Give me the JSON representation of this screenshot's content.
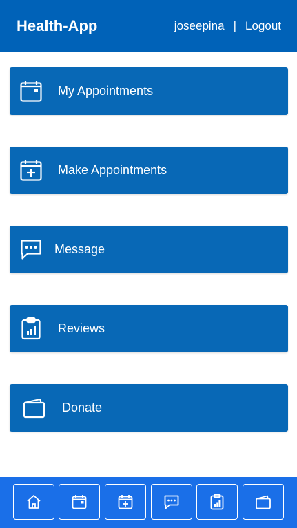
{
  "header": {
    "app_title": "Health-App",
    "username": "joseepina",
    "separator": "|",
    "logout_label": "Logout"
  },
  "menu": {
    "items": [
      {
        "label": "My Appointments",
        "icon": "calendar-icon"
      },
      {
        "label": "Make Appointments",
        "icon": "calendar-plus-icon"
      },
      {
        "label": "Message",
        "icon": "chat-icon"
      },
      {
        "label": "Reviews",
        "icon": "clipboard-chart-icon"
      },
      {
        "label": "Donate",
        "icon": "wallet-icon"
      }
    ]
  },
  "bottom_nav": {
    "items": [
      {
        "icon": "home-icon"
      },
      {
        "icon": "calendar-icon"
      },
      {
        "icon": "calendar-plus-icon"
      },
      {
        "icon": "chat-icon"
      },
      {
        "icon": "clipboard-chart-icon"
      },
      {
        "icon": "wallet-icon"
      }
    ]
  },
  "colors": {
    "header_bg": "#0062b8",
    "card_bg": "#0868b6",
    "footer_bg": "#1a6fe8",
    "text": "#ffffff"
  }
}
